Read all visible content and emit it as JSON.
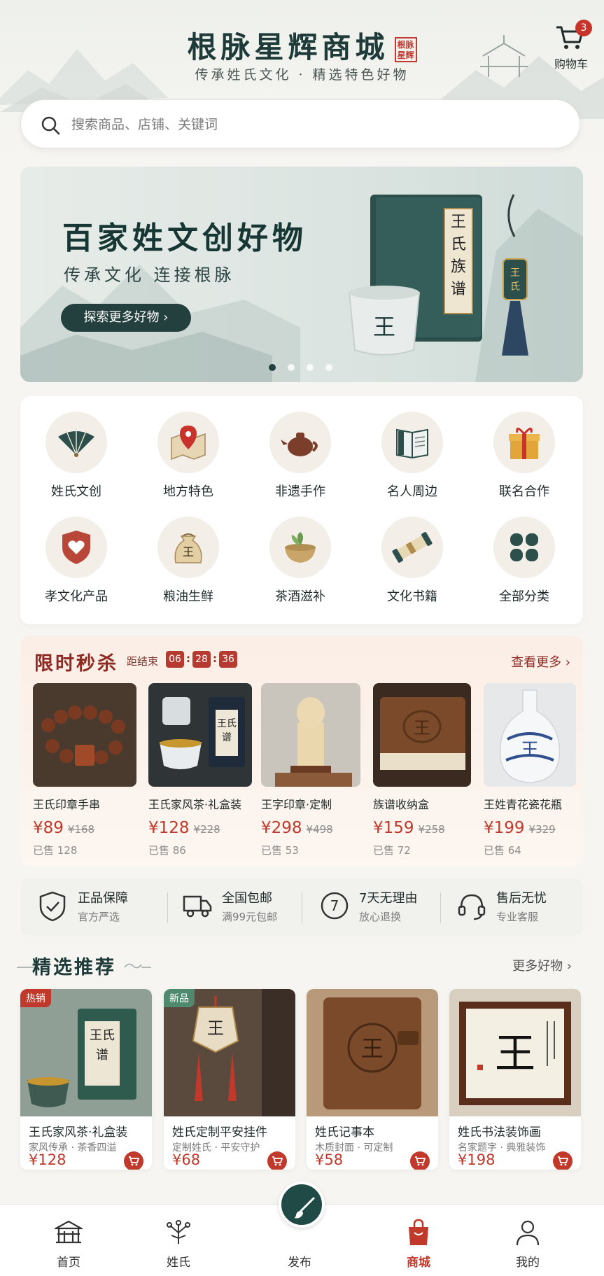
{
  "header": {
    "title": "根脉星辉商城",
    "seal_text": "根脉 星辉",
    "subtitle": "传承姓氏文化 · 精选特色好物",
    "cart_label": "购物车",
    "cart_count": "3"
  },
  "search": {
    "placeholder": "搜索商品、店铺、关键词"
  },
  "banner": {
    "title": "百家姓文创好物",
    "subtitle": "传承文化  连接根脉",
    "button_label": "探索更多好物 ›",
    "book_text": "王氏族谱",
    "cup_text": "王",
    "pendant_text": "王氏",
    "active_slide": 1,
    "slide_count": 4
  },
  "categories": [
    {
      "label": "姓氏文创",
      "icon": "folding-fan-icon"
    },
    {
      "label": "地方特色",
      "icon": "map-pin-icon"
    },
    {
      "label": "非遗手作",
      "icon": "teapot-icon"
    },
    {
      "label": "名人周边",
      "icon": "book-icon"
    },
    {
      "label": "联名合作",
      "icon": "gift-icon"
    },
    {
      "label": "孝文化产品",
      "icon": "heart-shield-icon"
    },
    {
      "label": "粮油生鲜",
      "icon": "grain-sack-icon"
    },
    {
      "label": "茶酒滋补",
      "icon": "tea-bowl-icon"
    },
    {
      "label": "文化书籍",
      "icon": "scroll-icon"
    },
    {
      "label": "全部分类",
      "icon": "grid-icon"
    }
  ],
  "flash_sale": {
    "title": "限时秒杀",
    "ends_label": "距结束",
    "hours": "06",
    "minutes": "28",
    "seconds": "36",
    "more_label": "查看更多 ›",
    "items": [
      {
        "name": "王氏印章手串",
        "price": "¥89",
        "old_price": "¥168",
        "sold": "已售 128"
      },
      {
        "name": "王氏家风茶·礼盒装",
        "price": "¥128",
        "old_price": "¥228",
        "sold": "已售 86"
      },
      {
        "name": "王字印章·定制",
        "price": "¥298",
        "old_price": "¥498",
        "sold": "已售 53"
      },
      {
        "name": "族谱收纳盒",
        "price": "¥159",
        "old_price": "¥258",
        "sold": "已售 72"
      },
      {
        "name": "王姓青花瓷花瓶",
        "price": "¥199",
        "old_price": "¥329",
        "sold": "已售 64"
      }
    ]
  },
  "guarantees": [
    {
      "title": "正品保障",
      "desc": "官方严选",
      "icon": "shield-check-icon"
    },
    {
      "title": "全国包邮",
      "desc": "满99元包邮",
      "icon": "truck-icon"
    },
    {
      "title": "7天无理由",
      "desc": "放心退换",
      "icon": "seven-day-icon"
    },
    {
      "title": "售后无忧",
      "desc": "专业客服",
      "icon": "headset-icon"
    }
  ],
  "recommended": {
    "title": "精选推荐",
    "more_label": "更多好物 ›",
    "items": [
      {
        "tag": "热销",
        "name": "王氏家风茶·礼盒装",
        "desc": "家风传承 · 茶香四溢",
        "price": "¥128",
        "box_text": "王氏谱"
      },
      {
        "tag": "新品",
        "name": "姓氏定制平安挂件",
        "desc": "定制姓氏 · 平安守护",
        "price": "¥68",
        "box_text": "王"
      },
      {
        "tag": "",
        "name": "姓氏记事本",
        "desc": "木质封面 · 可定制",
        "price": "¥58",
        "box_text": "王"
      },
      {
        "tag": "",
        "name": "姓氏书法装饰画",
        "desc": "名家题字 · 典雅装饰",
        "price": "¥198",
        "box_text": "王"
      }
    ]
  },
  "nav": {
    "items": [
      {
        "label": "首页",
        "icon": "pavilion-icon"
      },
      {
        "label": "姓氏",
        "icon": "family-tree-icon"
      },
      {
        "label": "发布",
        "icon": "brush-icon"
      },
      {
        "label": "商城",
        "icon": "shopping-bag-icon"
      },
      {
        "label": "我的",
        "icon": "user-icon"
      }
    ],
    "active": "商城"
  },
  "colors": {
    "brand_dark": "#1e3b3a",
    "accent_red": "#c0392b",
    "background": "#f6f5f1"
  }
}
